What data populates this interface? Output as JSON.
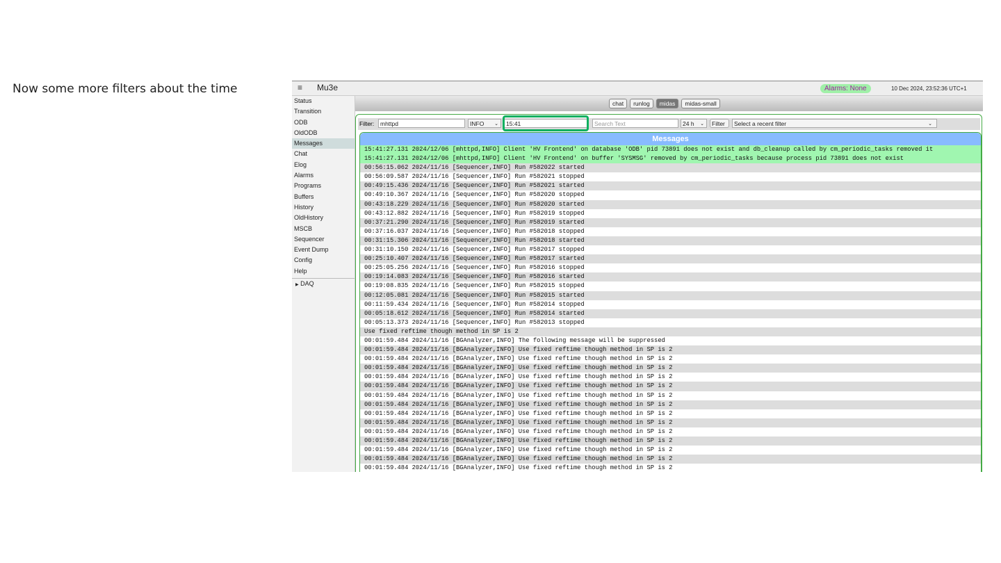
{
  "slide": {
    "caption": "Now some more filters about the time"
  },
  "header": {
    "menu_icon": "hamburger-icon",
    "title": "Mu3e",
    "alarms": "Alarms: None",
    "datetime": "10 Dec 2024, 23:52:36 UTC+1",
    "alarm_color": "#a0f0a8"
  },
  "sidebar": {
    "items": [
      "Status",
      "Transition",
      "ODB",
      "OldODB",
      "Messages",
      "Chat",
      "Elog",
      "Alarms",
      "Programs",
      "Buffers",
      "History",
      "OldHistory",
      "MSCB",
      "Sequencer",
      "Event Dump",
      "Config",
      "Help"
    ],
    "active": "Messages",
    "group": "DAQ"
  },
  "tabs": [
    "chat",
    "runlog",
    "midas",
    "midas-small"
  ],
  "selected_tab": "midas",
  "filter": {
    "label": "Filter:",
    "name_value": "mhttpd",
    "type_value": "INFO",
    "time_value": "15:41",
    "search_placeholder": "Search Text",
    "range_value": "24 h",
    "filter_button": "Filter",
    "recent_placeholder": "Select a recent filter"
  },
  "messages": {
    "title": "Messages",
    "highlighted": [
      "15:41:27.131 2024/12/06 [mhttpd,INFO] Client 'HV Frontend' on database 'ODB' pid 73891 does not exist and db_cleanup called by cm_periodic_tasks removed it",
      "15:41:27.131 2024/12/06 [mhttpd,INFO] Client 'HV Frontend' on buffer 'SYSMSG' removed by cm_periodic_tasks because process pid 73891 does not exist"
    ],
    "rows": [
      "00:56:15.062 2024/11/16 [Sequencer,INFO] Run #582022 started",
      "00:56:09.587 2024/11/16 [Sequencer,INFO] Run #582021 stopped",
      "00:49:15.436 2024/11/16 [Sequencer,INFO] Run #582021 started",
      "00:49:10.367 2024/11/16 [Sequencer,INFO] Run #582020 stopped",
      "00:43:18.229 2024/11/16 [Sequencer,INFO] Run #582020 started",
      "00:43:12.882 2024/11/16 [Sequencer,INFO] Run #582019 stopped",
      "00:37:21.290 2024/11/16 [Sequencer,INFO] Run #582019 started",
      "00:37:16.037 2024/11/16 [Sequencer,INFO] Run #582018 stopped",
      "00:31:15.306 2024/11/16 [Sequencer,INFO] Run #582018 started",
      "00:31:10.150 2024/11/16 [Sequencer,INFO] Run #582017 stopped",
      "00:25:10.407 2024/11/16 [Sequencer,INFO] Run #582017 started",
      "00:25:05.256 2024/11/16 [Sequencer,INFO] Run #582016 stopped",
      "00:19:14.083 2024/11/16 [Sequencer,INFO] Run #582016 started",
      "00:19:08.835 2024/11/16 [Sequencer,INFO] Run #582015 stopped",
      "00:12:05.081 2024/11/16 [Sequencer,INFO] Run #582015 started",
      "00:11:59.434 2024/11/16 [Sequencer,INFO] Run #582014 stopped",
      "00:05:18.612 2024/11/16 [Sequencer,INFO] Run #582014 started",
      "00:05:13.373 2024/11/16 [Sequencer,INFO] Run #582013 stopped",
      "Use fixed reftime though method in SP is 2",
      "00:01:59.484 2024/11/16 [BGAnalyzer,INFO] The following message will be suppressed",
      "00:01:59.484 2024/11/16 [BGAnalyzer,INFO] Use fixed reftime though method in SP is 2",
      "00:01:59.484 2024/11/16 [BGAnalyzer,INFO] Use fixed reftime though method in SP is 2",
      "00:01:59.484 2024/11/16 [BGAnalyzer,INFO] Use fixed reftime though method in SP is 2",
      "00:01:59.484 2024/11/16 [BGAnalyzer,INFO] Use fixed reftime though method in SP is 2",
      "00:01:59.484 2024/11/16 [BGAnalyzer,INFO] Use fixed reftime though method in SP is 2",
      "00:01:59.484 2024/11/16 [BGAnalyzer,INFO] Use fixed reftime though method in SP is 2",
      "00:01:59.484 2024/11/16 [BGAnalyzer,INFO] Use fixed reftime though method in SP is 2",
      "00:01:59.484 2024/11/16 [BGAnalyzer,INFO] Use fixed reftime though method in SP is 2",
      "00:01:59.484 2024/11/16 [BGAnalyzer,INFO] Use fixed reftime though method in SP is 2",
      "00:01:59.484 2024/11/16 [BGAnalyzer,INFO] Use fixed reftime though method in SP is 2",
      "00:01:59.484 2024/11/16 [BGAnalyzer,INFO] Use fixed reftime though method in SP is 2",
      "00:01:59.484 2024/11/16 [BGAnalyzer,INFO] Use fixed reftime though method in SP is 2",
      "00:01:59.484 2024/11/16 [BGAnalyzer,INFO] Use fixed reftime though method in SP is 2",
      "00:01:59.484 2024/11/16 [BGAnalyzer,INFO] Use fixed reftime though method in SP is 2"
    ]
  }
}
